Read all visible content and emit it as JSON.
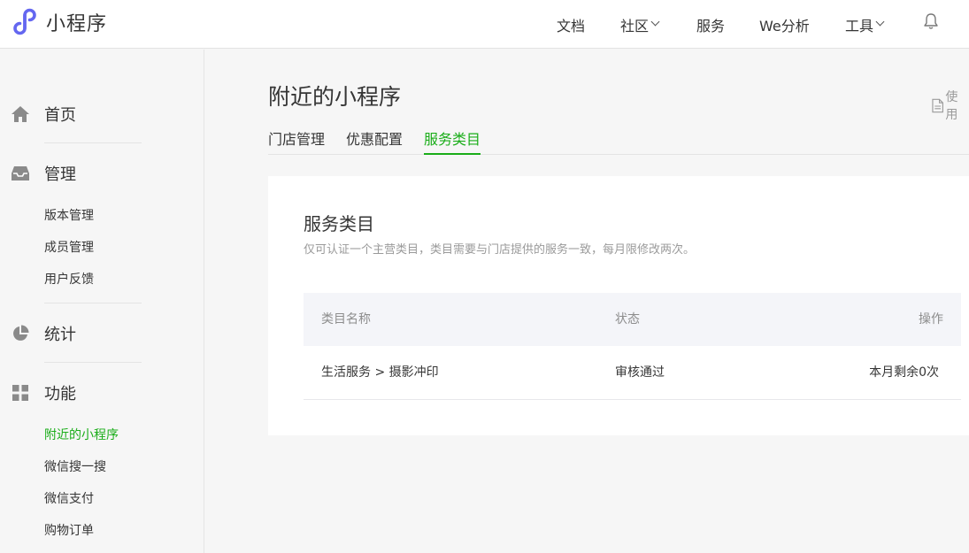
{
  "header": {
    "logo_text": "小程序",
    "nav": [
      {
        "label": "文档"
      },
      {
        "label": "社区"
      },
      {
        "label": "服务"
      },
      {
        "label": "We分析"
      },
      {
        "label": "工具"
      }
    ]
  },
  "sidebar": {
    "groups": [
      {
        "label": "首页",
        "icon": "home-icon",
        "items": []
      },
      {
        "label": "管理",
        "icon": "inbox-icon",
        "items": [
          "版本管理",
          "成员管理",
          "用户反馈"
        ]
      },
      {
        "label": "统计",
        "icon": "pie-chart-icon",
        "items": []
      },
      {
        "label": "功能",
        "icon": "grid-icon",
        "items": [
          "附近的小程序",
          "微信搜一搜",
          "微信支付",
          "购物订单"
        ]
      }
    ],
    "active_item": "附近的小程序"
  },
  "main": {
    "title": "附近的小程序",
    "use_link": "使用",
    "tabs": [
      "门店管理",
      "优惠配置",
      "服务类目"
    ],
    "active_tab": "服务类目",
    "section_title": "服务类目",
    "section_desc": "仅可认证一个主营类目，类目需要与门店提供的服务一致，每月限修改两次。",
    "table": {
      "columns": [
        "类目名称",
        "状态",
        "操作"
      ],
      "rows": [
        {
          "category": "生活服务 > 摄影冲印",
          "status": "审核通过",
          "action": "本月剩余0次"
        }
      ]
    }
  },
  "colors": {
    "accent": "#1aad19",
    "logo": "#6467f0"
  }
}
